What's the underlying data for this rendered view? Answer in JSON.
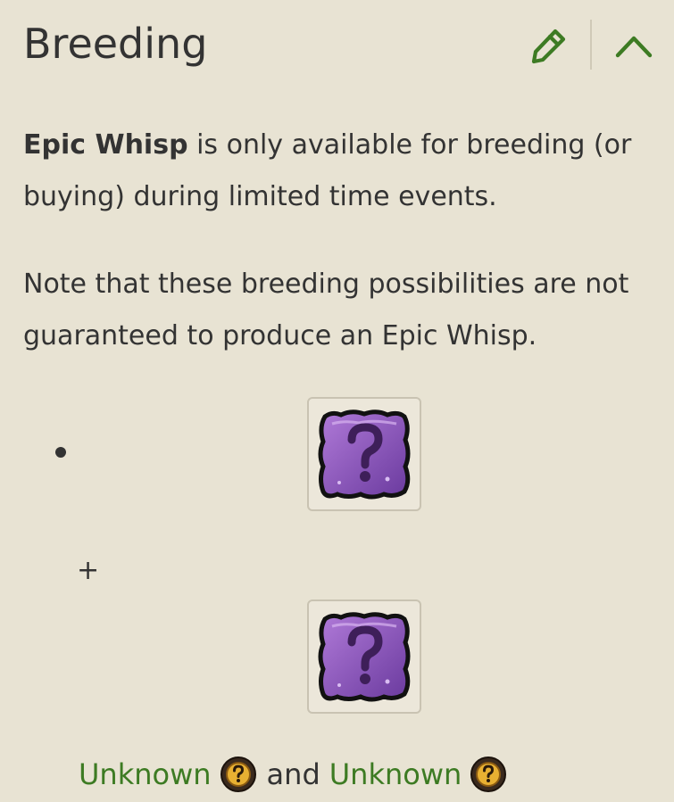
{
  "section": {
    "title": "Breeding",
    "edit_icon": "pencil-icon",
    "collapse_icon": "chevron-up-icon",
    "accent_color": "#3d7b23"
  },
  "intro": {
    "monster_name": "Epic Whisp",
    "text": " is only available for breeding (or buying) during limited time events."
  },
  "note": "Note that these breeding possibilities are not guaranteed to produce an Epic Whisp.",
  "combination": {
    "operator": "+",
    "parent_1_icon": "unknown-monster-icon",
    "parent_2_icon": "unknown-monster-icon",
    "parent_1_name": "Unknown",
    "joiner": "and",
    "parent_2_name": "Unknown",
    "mini_icon": "question-mark-coin-icon"
  }
}
